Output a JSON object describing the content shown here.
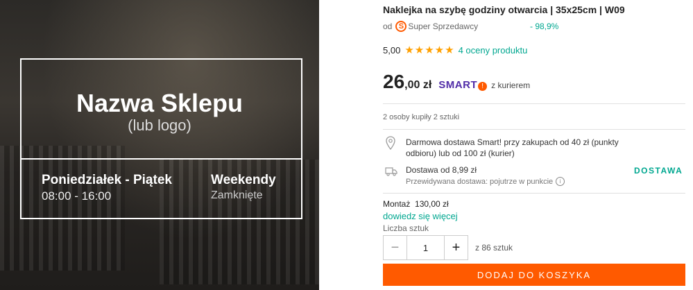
{
  "image": {
    "shop_name": "Nazwa Sklepu",
    "shop_sub": "(lub logo)",
    "weekdays_label": "Poniedziałek - Piątek",
    "weekdays_hours": "08:00 - 16:00",
    "weekend_label": "Weekendy",
    "weekend_status": "Zamknięte"
  },
  "product": {
    "title": "Naklejka na szybę godziny otwarcia | 35x25cm | W09",
    "seller_prefix": "od",
    "seller_badge_icon": "super-seller-icon",
    "seller_name": "Super Sprzedawcy",
    "seller_percent": "- 98,9%",
    "rating_value": "5,00",
    "rating_stars": 5,
    "stars_display": "★★★★★",
    "rating_link": "4 oceny produktu",
    "price_int": "26",
    "price_dec": ",00 zł",
    "smart_label": "SMART",
    "smart_suffix": "z kurierem",
    "bought_text": "2 osoby kupiły 2 sztuki"
  },
  "delivery": {
    "free_text": "Darmowa dostawa Smart! przy zakupach od 40 zł (punkty odbioru) lub od 100 zł (kurier)",
    "from_text": "Dostawa od 8,99 zł",
    "estimate_text": "Przewidywana dostawa: pojutrze w punkcie",
    "link": "DOSTAWA"
  },
  "mount": {
    "text": "Montaż  130,00 zł",
    "more_link": "dowiedz się więcej"
  },
  "quantity": {
    "label": "Liczba sztuk",
    "value": "1",
    "minus": "−",
    "plus": "+",
    "of_text": "z 86 sztuk"
  },
  "cart": {
    "button_label": "DODAJ DO KOSZYKA"
  },
  "colors": {
    "accent": "#ff5a00",
    "teal": "#00a790",
    "smart_purple": "#512da8",
    "star": "#ffa000"
  }
}
